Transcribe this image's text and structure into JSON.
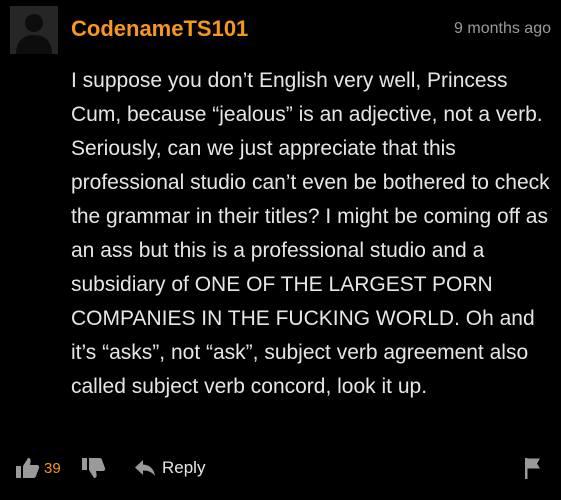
{
  "comment": {
    "author": "CodenameTS101",
    "timestamp": "9 months ago",
    "text": "I suppose you don’t English very well, Princess Cum, because “jealous” is an adjective, not a verb. Seriously, can we just appreciate that this professional studio can’t even be bothered to check the grammar in their titles? I might be coming off as an ass but this is a professional studio and a subsidiary of ONE OF THE LARGEST PORN COMPANIES IN THE FUCKING WORLD. Oh and it’s “asks”, not “ask”, subject verb agreement also called subject verb concord, look it up.",
    "likes": "39",
    "reply_label": "Reply"
  },
  "icons": {
    "avatar": "default-user-silhouette",
    "like": "thumbs-up-icon",
    "dislike": "thumbs-down-icon",
    "reply": "reply-arrow-icon",
    "flag": "flag-icon"
  },
  "colors": {
    "background": "#000000",
    "username": "#f7971d",
    "like_count": "#f7971d",
    "text": "#e6e6e6",
    "muted": "#9a9a9a"
  }
}
